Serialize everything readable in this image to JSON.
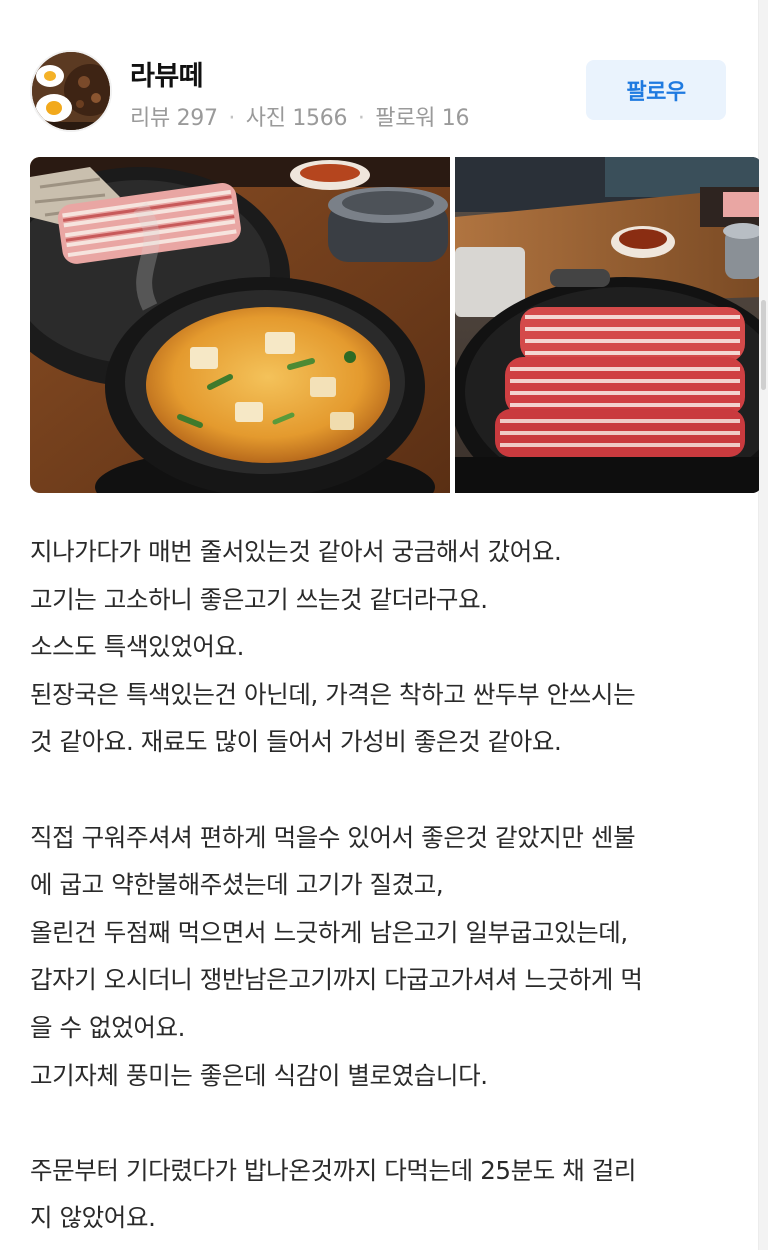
{
  "profile": {
    "username": "라뷰떼",
    "stats": {
      "reviews": "리뷰 297",
      "photos": "사진 1566",
      "followers": "팔로워 16",
      "separator": "·"
    },
    "follow_label": "팔로우"
  },
  "photos": [
    {
      "icon": "food-photo-stew-and-pork-belly"
    },
    {
      "icon": "food-photo-raw-pork-on-grill"
    }
  ],
  "review": {
    "lines": [
      "지나가다가 매번 줄서있는것 같아서 궁금해서 갔어요.",
      "고기는 고소하니 좋은고기 쓰는것 같더라구요.",
      "소스도 특색있었어요.",
      "된장국은 특색있는건 아닌데, 가격은 착하고 싼두부 안쓰시는",
      "것 같아요. 재료도 많이 들어서 가성비 좋은것 같아요.",
      "",
      "직접 구워주셔셔 편하게 먹을수 있어서 좋은것 같았지만 센불",
      "에 굽고 약한불해주셨는데 고기가 질겼고,",
      "올린건 두점째 먹으면서 느긋하게 남은고기 일부굽고있는데,",
      "갑자기 오시더니 쟁반남은고기까지 다굽고가셔셔 느긋하게 먹",
      "을 수 없었어요.",
      "고기자체 풍미는 좋은데 식감이 별로였습니다.",
      "",
      "주문부터 기다렸다가 밥나온것까지 다먹는데 25분도 채 걸리",
      "지 않았어요."
    ]
  },
  "colors": {
    "follow_bg": "#eaf3fd",
    "follow_text": "#1f7ae0",
    "meta_text": "#9a9a9a",
    "body_text": "#2a2a2a"
  }
}
